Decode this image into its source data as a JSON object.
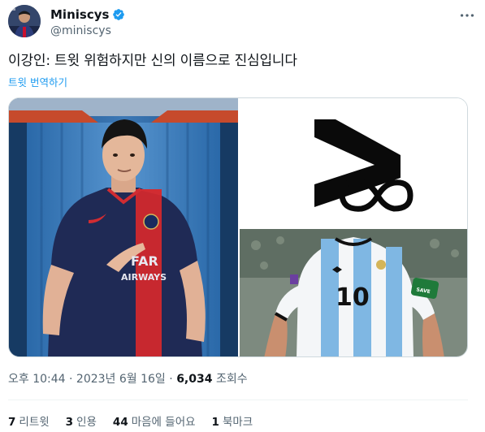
{
  "author": {
    "display_name": "Miniscys",
    "handle": "@miniscys",
    "avatar_icon": "avatar-photo",
    "verified_icon": "verified-badge-icon",
    "verified_color": "#1d9bf0"
  },
  "more_icon": "more-options-icon",
  "tweet": {
    "text": "이강인: 트윗 위험하지만 신의 이름으로 진심입니다",
    "translate_label": "트윗 번역하기"
  },
  "media": [
    {
      "id": "left",
      "subject": "player-in-navy-red-kit-photo"
    },
    {
      "id": "top-right",
      "subject": "black-logo-with-infinity-symbol"
    },
    {
      "id": "bottom-right",
      "subject": "player-in-light-blue-white-striped-kit-number-10-photo"
    }
  ],
  "meta": {
    "time": "오후 10:44",
    "date": "2023년 6월 16일",
    "views_count": "6,034",
    "views_label": "조회수",
    "separator": "·"
  },
  "stats": {
    "retweets": {
      "count": "7",
      "label": "리트윗"
    },
    "quotes": {
      "count": "3",
      "label": "인용"
    },
    "likes": {
      "count": "44",
      "label": "마음에 들어요"
    },
    "bookmarks": {
      "count": "1",
      "label": "북마크"
    }
  },
  "colors": {
    "accent": "#1d9bf0",
    "text_primary": "#0f1419",
    "text_secondary": "#536471",
    "border": "#cfd9de"
  }
}
